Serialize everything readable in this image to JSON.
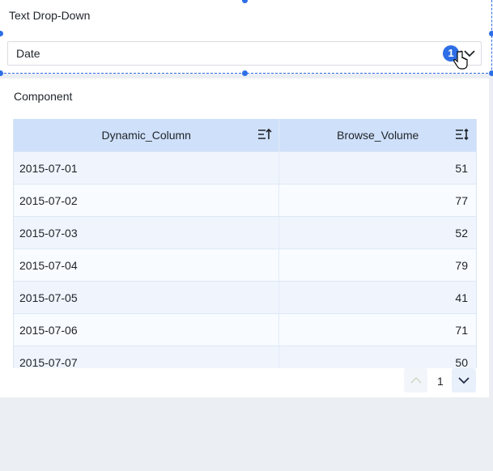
{
  "dropdown_widget": {
    "title": "Text Drop-Down",
    "selected_value": "Date",
    "badge_count": "1"
  },
  "component": {
    "title": "Component",
    "columns": [
      "Dynamic_Column",
      "Browse_Volume"
    ],
    "rows": [
      [
        "2015-07-01",
        "51"
      ],
      [
        "2015-07-02",
        "77"
      ],
      [
        "2015-07-03",
        "52"
      ],
      [
        "2015-07-04",
        "79"
      ],
      [
        "2015-07-05",
        "41"
      ],
      [
        "2015-07-06",
        "71"
      ],
      [
        "2015-07-07",
        "50"
      ]
    ],
    "pagination": {
      "page": "1"
    }
  },
  "colors": {
    "accent": "#2e6ee6",
    "header_bg": "#cfe0fa"
  }
}
